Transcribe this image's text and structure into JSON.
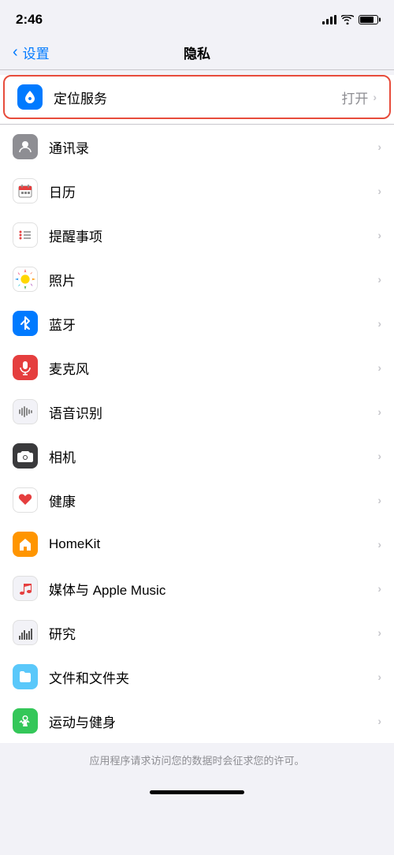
{
  "statusBar": {
    "time": "2:46",
    "signal": "signal",
    "wifi": "wifi",
    "battery": "battery"
  },
  "navBar": {
    "backLabel": "设置",
    "title": "隐私"
  },
  "listItems": [
    {
      "id": "location",
      "label": "定位服务",
      "value": "打开",
      "iconBg": "#007aff",
      "iconColor": "#fff",
      "highlighted": true
    },
    {
      "id": "contacts",
      "label": "通讯录",
      "value": "",
      "iconBg": "#8e8e93",
      "iconColor": "#fff",
      "highlighted": false
    },
    {
      "id": "calendar",
      "label": "日历",
      "value": "",
      "iconBg": "#fff",
      "iconColor": "#e53e3e",
      "highlighted": false
    },
    {
      "id": "reminders",
      "label": "提醒事项",
      "value": "",
      "iconBg": "#fff",
      "iconColor": "#e53e3e",
      "highlighted": false
    },
    {
      "id": "photos",
      "label": "照片",
      "value": "",
      "iconBg": "#fff",
      "iconColor": "#e53e3e",
      "highlighted": false
    },
    {
      "id": "bluetooth",
      "label": "蓝牙",
      "value": "",
      "iconBg": "#007aff",
      "iconColor": "#fff",
      "highlighted": false
    },
    {
      "id": "microphone",
      "label": "麦克风",
      "value": "",
      "iconBg": "#e53e3e",
      "iconColor": "#fff",
      "highlighted": false
    },
    {
      "id": "speech",
      "label": "语音识别",
      "value": "",
      "iconBg": "#f2f2f7",
      "iconColor": "#555",
      "highlighted": false
    },
    {
      "id": "camera",
      "label": "相机",
      "value": "",
      "iconBg": "#3a3a3c",
      "iconColor": "#fff",
      "highlighted": false
    },
    {
      "id": "health",
      "label": "健康",
      "value": "",
      "iconBg": "#fff",
      "iconColor": "#e53e3e",
      "highlighted": false
    },
    {
      "id": "homekit",
      "label": "HomeKit",
      "value": "",
      "iconBg": "#ff9500",
      "iconColor": "#fff",
      "highlighted": false
    },
    {
      "id": "media",
      "label": "媒体与 Apple Music",
      "value": "",
      "iconBg": "#f2f2f7",
      "iconColor": "#e53e3e",
      "highlighted": false
    },
    {
      "id": "research",
      "label": "研究",
      "value": "",
      "iconBg": "#f2f2f7",
      "iconColor": "#555",
      "highlighted": false
    },
    {
      "id": "files",
      "label": "文件和文件夹",
      "value": "",
      "iconBg": "#5ac8fa",
      "iconColor": "#fff",
      "highlighted": false
    },
    {
      "id": "fitness",
      "label": "运动与健身",
      "value": "",
      "iconBg": "#34c759",
      "iconColor": "#fff",
      "highlighted": false
    }
  ],
  "footer": {
    "text": "应用程序请求访问您的数据时会征求您的许可。"
  }
}
